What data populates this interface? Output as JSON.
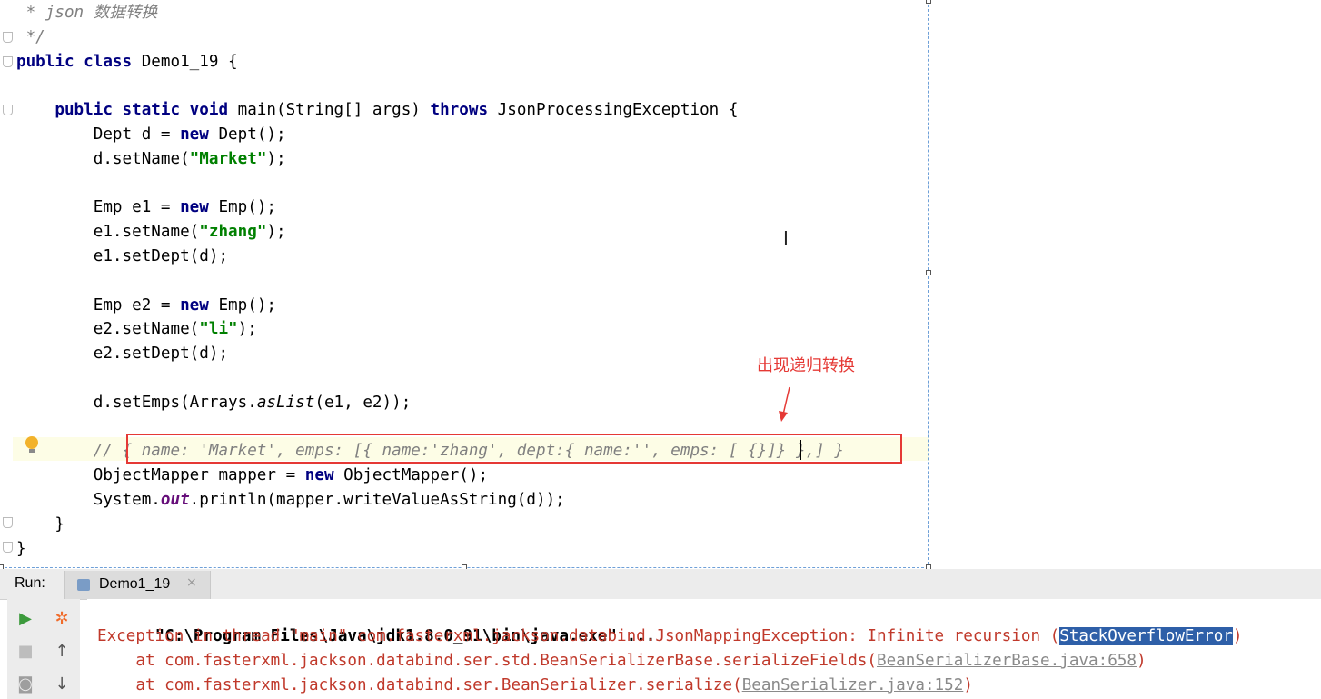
{
  "editor": {
    "lines": [
      {
        "parts": [
          {
            "t": " * json 数据转换",
            "c": "cm"
          }
        ]
      },
      {
        "parts": [
          {
            "t": " */",
            "c": "cm"
          }
        ]
      },
      {
        "parts": [
          {
            "t": "public class ",
            "c": "kw"
          },
          {
            "t": "Demo1_19 {",
            "c": ""
          }
        ]
      },
      {
        "parts": [
          {
            "t": "",
            "c": ""
          }
        ]
      },
      {
        "parts": [
          {
            "t": "    public static void ",
            "c": "kw"
          },
          {
            "t": "main(String[] args) ",
            "c": ""
          },
          {
            "t": "throws ",
            "c": "kw"
          },
          {
            "t": "JsonProcessingException {",
            "c": ""
          }
        ]
      },
      {
        "parts": [
          {
            "t": "        Dept d = ",
            "c": ""
          },
          {
            "t": "new ",
            "c": "kw"
          },
          {
            "t": "Dept();",
            "c": ""
          }
        ]
      },
      {
        "parts": [
          {
            "t": "        d.setName(",
            "c": ""
          },
          {
            "t": "\"Market\"",
            "c": "str"
          },
          {
            "t": ");",
            "c": ""
          }
        ]
      },
      {
        "parts": [
          {
            "t": "",
            "c": ""
          }
        ]
      },
      {
        "parts": [
          {
            "t": "        Emp e1 = ",
            "c": ""
          },
          {
            "t": "new ",
            "c": "kw"
          },
          {
            "t": "Emp();",
            "c": ""
          }
        ]
      },
      {
        "parts": [
          {
            "t": "        e1.setName(",
            "c": ""
          },
          {
            "t": "\"zhang\"",
            "c": "str"
          },
          {
            "t": ");",
            "c": ""
          }
        ]
      },
      {
        "parts": [
          {
            "t": "        e1.setDept(d);",
            "c": ""
          }
        ]
      },
      {
        "parts": [
          {
            "t": "",
            "c": ""
          }
        ]
      },
      {
        "parts": [
          {
            "t": "        Emp e2 = ",
            "c": ""
          },
          {
            "t": "new ",
            "c": "kw"
          },
          {
            "t": "Emp();",
            "c": ""
          }
        ]
      },
      {
        "parts": [
          {
            "t": "        e2.setName(",
            "c": ""
          },
          {
            "t": "\"li\"",
            "c": "str"
          },
          {
            "t": ");",
            "c": ""
          }
        ]
      },
      {
        "parts": [
          {
            "t": "        e2.setDept(d);",
            "c": ""
          }
        ]
      },
      {
        "parts": [
          {
            "t": "",
            "c": ""
          }
        ]
      },
      {
        "parts": [
          {
            "t": "        d.setEmps(Arrays.",
            "c": ""
          },
          {
            "t": "asList",
            "c": "it"
          },
          {
            "t": "(e1, e2));",
            "c": ""
          }
        ]
      },
      {
        "parts": [
          {
            "t": "",
            "c": ""
          }
        ]
      },
      {
        "parts": [
          {
            "t": "        // { name: 'Market', emps: [{ name:'zhang', dept:{ name:'', emps: [ {}]} },] }",
            "c": "cm"
          }
        ]
      },
      {
        "parts": [
          {
            "t": "        ObjectMapper mapper = ",
            "c": ""
          },
          {
            "t": "new ",
            "c": "kw"
          },
          {
            "t": "ObjectMapper();",
            "c": ""
          }
        ]
      },
      {
        "parts": [
          {
            "t": "        System.",
            "c": ""
          },
          {
            "t": "out",
            "c": "fld"
          },
          {
            "t": ".println(mapper.writeValueAsString(d));",
            "c": ""
          }
        ]
      },
      {
        "parts": [
          {
            "t": "    }",
            "c": ""
          }
        ]
      },
      {
        "parts": [
          {
            "t": "}",
            "c": ""
          }
        ]
      }
    ]
  },
  "annotation": {
    "text": "出现递归转换",
    "color": "#e53935"
  },
  "run_panel": {
    "label": "Run:",
    "tab_label": "Demo1_19",
    "tab_close": "×",
    "tools_left": [
      "play-icon",
      "stop-icon",
      "camera-icon"
    ],
    "tools_right": [
      "bug-icon",
      "arrow-up-icon",
      "arrow-down-icon"
    ],
    "console": {
      "line1": "\"C:\\Program Files\\Java\\jdk1.8.0_91\\bin\\java.exe\" ...",
      "line2_prefix": "Exception in thread \"main\" com.fasterxml.jackson.databind.JsonMappingException: Infinite recursion (",
      "line2_selected": "StackOverflowError",
      "line2_suffix": ")",
      "line3_prefix": "    at com.fasterxml.jackson.databind.ser.std.BeanSerializerBase.serializeFields(",
      "line3_link": "BeanSerializerBase.java:658",
      "line3_suffix": ")",
      "line4_prefix": "    at com.fasterxml.jackson.databind.ser.BeanSerializer.serialize(",
      "line4_link": "BeanSerializer.java:152",
      "line4_suffix": ")"
    }
  }
}
